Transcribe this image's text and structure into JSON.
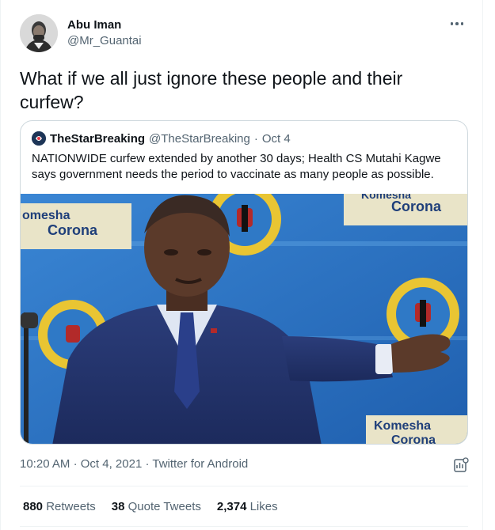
{
  "author": {
    "name": "Abu Iman",
    "handle": "@Mr_Guantai"
  },
  "tweet": {
    "text": "What if we all just ignore these people and their curfew?"
  },
  "quote": {
    "name": "TheStarBreaking",
    "handle": "@TheStarBreaking",
    "separator": "·",
    "date": "Oct 4",
    "text": "NATIONWIDE curfew extended by another 30 days; Health CS Mutahi Kagwe says government needs the period to vaccinate as many people as possible.",
    "image_signs": {
      "left_line1": "omesha",
      "left_line2": "Corona",
      "right_top": "Corona",
      "right_top_partial": "Komesha",
      "bottom_line1": "Komesha",
      "bottom_line2": "Corona"
    }
  },
  "meta": {
    "time": "10:20 AM",
    "sep1": "·",
    "date": "Oct 4, 2021",
    "sep2": "·",
    "client": "Twitter for Android"
  },
  "stats": {
    "retweets": {
      "count": "880",
      "label": "Retweets"
    },
    "quotes": {
      "count": "38",
      "label": "Quote Tweets"
    },
    "likes": {
      "count": "2,374",
      "label": "Likes"
    }
  },
  "icons": {
    "more": "more-horizontal-icon",
    "analytics": "analytics-icon"
  },
  "colors": {
    "text": "#0f1419",
    "secondary": "#536471",
    "border": "#cfd9de",
    "backdrop_blue": "#2f79c6",
    "seal_yellow": "#e9c533"
  }
}
